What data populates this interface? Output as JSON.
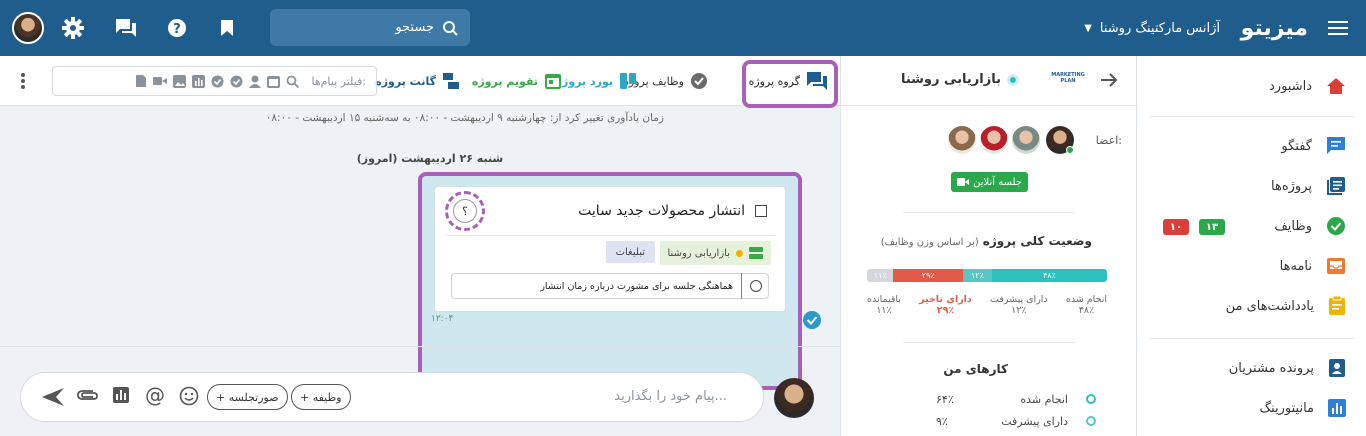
{
  "header": {
    "logo": "میزیتو",
    "workspace": "آژانس مارکتینگ روشنا",
    "search_placeholder": "جستجو",
    "icons": [
      "menu-icon",
      "chevron-down-icon",
      "search-icon",
      "bookmark-icon",
      "help-icon",
      "chat-icon",
      "gear-icon"
    ]
  },
  "sidebar": {
    "items": [
      {
        "label": "داشبورد",
        "icon": "home-icon",
        "color": "#d9403a"
      },
      {
        "label": "گفتگو",
        "icon": "chat-icon",
        "color": "#2f7fd2"
      },
      {
        "label": "پروژه‌ها",
        "icon": "projects-icon",
        "color": "#1e5d8c"
      },
      {
        "label": "وظایف",
        "icon": "check-circle-icon",
        "color": "#2aa84a"
      },
      {
        "label": "نامه‌ها",
        "icon": "mail-icon",
        "color": "#f07a30"
      },
      {
        "label": "یادداشت‌های من",
        "icon": "note-icon",
        "color": "#f0b400"
      },
      {
        "label": "پرونده مشتریان",
        "icon": "contacts-icon",
        "color": "#1e5d8c"
      },
      {
        "label": "مانیتورینگ",
        "icon": "monitoring-icon",
        "color": "#2f7fd2"
      }
    ],
    "tasks_badges": {
      "green": "۱۳",
      "red": "۱۰"
    }
  },
  "project": {
    "name": "بازاریابی روشنا",
    "logo_text": "MARKETING PLAN",
    "members_label": "اعضا:",
    "online_meeting": "جلسه آنلاین",
    "status_title": "وضعیت کلی پروژه",
    "status_subtitle": "(بر اساس وزن وظایف)",
    "progress": [
      {
        "label": "انجام شده",
        "value": "۴۸٪",
        "pct": 48,
        "color": "#2fbfbf"
      },
      {
        "label": "دارای پیشرفت",
        "value": "۱۲٪",
        "pct": 12,
        "color": "#5bc4c4"
      },
      {
        "label": "دارای تاخیر",
        "value": "۲۹٪",
        "pct": 29,
        "color": "#e25a4a"
      },
      {
        "label": "باقیمانده",
        "value": "۱۱٪",
        "pct": 11,
        "color": "#d4d8dc"
      }
    ],
    "my_tasks_title": "کارهای من",
    "my_tasks": [
      {
        "label": "انجام شده",
        "value": "۶۴٪",
        "color": "#2fbfbf"
      },
      {
        "label": "دارای پیشرفت",
        "value": "۹٪",
        "color": "#5bc4c4"
      }
    ]
  },
  "toolbar": {
    "tabs": [
      {
        "label": "گروه پروژه",
        "icon": "forum-icon",
        "color": "#1e5d8c"
      },
      {
        "label": "وظایف پروژه",
        "icon": "tasks-icon",
        "color": "#6b6b6b"
      },
      {
        "label": "بورد پروژه",
        "icon": "board-icon",
        "color": "#2aa8c8"
      },
      {
        "label": "تقویم پروژه",
        "icon": "calendar-icon",
        "color": "#3aa84a"
      },
      {
        "label": "گانت پروژه",
        "icon": "gantt-icon",
        "color": "#1e5d8c"
      }
    ],
    "filter_label": "فیلتر پیام‌ها:",
    "filter_icons": [
      "search-icon",
      "calendar-icon",
      "person-icon",
      "check-icon",
      "approve-icon",
      "chart-icon",
      "image-icon",
      "video-icon",
      "file-icon"
    ]
  },
  "chat": {
    "reminder": "زمان یادآوری تغییر کرد از: چهارشنبه ۹ اردیبهشت - ۰۸:۰۰ به سه‌شنبه ۱۵ اردیبهشت - ۰۸:۰۰",
    "date": "شنبه ۲۶ اردیبهشت (امروز)",
    "card": {
      "title": "انتشار محصولات جدید سایت",
      "assignee": "؟",
      "project_tag": "بازاریابی روشنا",
      "tag": "تبلیغات",
      "subtask": "هماهنگی جلسه برای مشورت درباره زمان انتشار",
      "time": "۱۲:۰۴"
    }
  },
  "composer": {
    "placeholder": "پیام خود را بگذارید...",
    "task_button": "+ وظیفه",
    "minutes_button": "+ صورتجلسه"
  }
}
